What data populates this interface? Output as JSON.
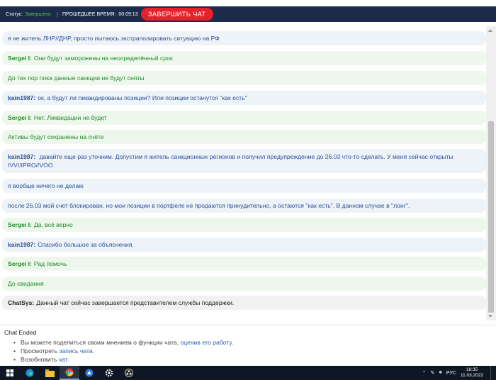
{
  "header": {
    "status_label": "Статус:",
    "status_value": "Завершено",
    "elapsed_label": "ПРОШЕДШЕЕ ВРЕМЯ:",
    "elapsed_value": "00:09:13",
    "end_chat_label": "ЗАВЕРШИТЬ ЧАТ"
  },
  "messages": [
    {
      "role": "user",
      "sender": "",
      "text": "я не житель ЛНР//ДНР, просто пытаюсь экстраполировать ситуацию на РФ"
    },
    {
      "role": "agent",
      "sender": "Sergei I:",
      "text": "Они будут заморожены на неопределённый срок"
    },
    {
      "role": "agent",
      "sender": "",
      "text": "До тех пор пока данные санкции не будут сняты"
    },
    {
      "role": "user",
      "sender": "kain1987:",
      "text": "ок, а будут ли ликвидированы позиции? Или позиции останутся \"как есть\""
    },
    {
      "role": "agent",
      "sender": "Sergei I:",
      "text": "Нет. Ликвидации не будет"
    },
    {
      "role": "agent",
      "sender": "",
      "text": "Активы будут сохранены на счёте"
    },
    {
      "role": "user",
      "sender": "kain1987:",
      "text": "давайте еще раз уточним. Допустим я житель санкционных регионов и получил предупреждение до 26.03 что-то сделать. У меня сейчас открыты IVV//IPRO//VOO"
    },
    {
      "role": "user",
      "sender": "",
      "text": "я вообще ничего не делаю"
    },
    {
      "role": "user",
      "sender": "",
      "text": "после 26.03 мой счет блокирован, но мои позиции в портфеле не продаются принудительно, а остаются \"как есть\". В данном случае в \"лонг\"."
    },
    {
      "role": "agent",
      "sender": "Sergei I:",
      "text": "Да, всё верно"
    },
    {
      "role": "user",
      "sender": "kain1987:",
      "text": "Спасибо большое за объяснения."
    },
    {
      "role": "agent",
      "sender": "Sergei I:",
      "text": "Рад помочь"
    },
    {
      "role": "agent",
      "sender": "",
      "text": "До свидания"
    },
    {
      "role": "sys",
      "sender": "ChatSys:",
      "text": "Данный чат сейчас завершается представителем службы поддержки."
    }
  ],
  "footer": {
    "ended_title": "Chat Ended",
    "opt1_text": "Вы можете поделиться своим мнением о функции чата,",
    "opt1_link": "оценив его работу",
    "opt1_end": ".",
    "opt2_text": "Просмотреть",
    "opt2_link": "запись чата",
    "opt2_end": ".",
    "opt3_text": "Возобновить",
    "opt3_link": "чат",
    "opt3_end": "."
  },
  "taskbar": {
    "lang": "РУС",
    "time": "18:35",
    "date": "11.03.2022",
    "icons": [
      "windows-icon",
      "edge-icon",
      "file-explorer-icon",
      "chrome-icon",
      "app-icon",
      "settings-icon",
      "obs-icon"
    ]
  },
  "colors": {
    "header_bg": "#1c2b4a",
    "status_green": "#4fbf5a",
    "end_button": "#e8202a",
    "agent_text": "#1f8a27",
    "user_text": "#2a4f99"
  }
}
